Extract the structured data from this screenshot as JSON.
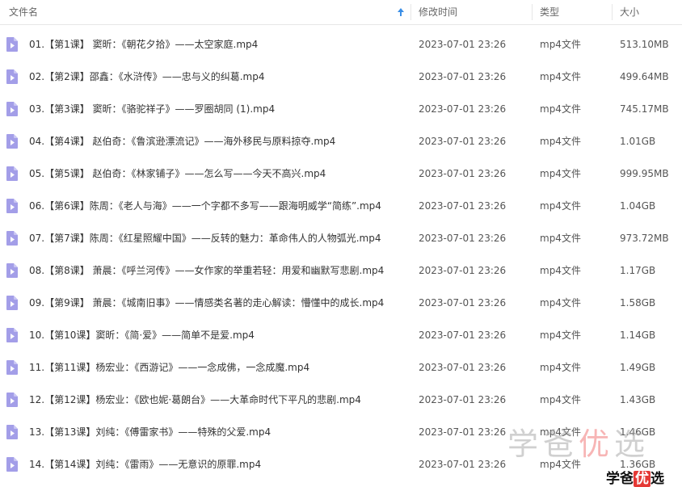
{
  "header": {
    "name": "文件名",
    "date": "修改时间",
    "type": "类型",
    "size": "大小"
  },
  "colors": {
    "file_icon": "#a39ee8",
    "sort_arrow": "#3a8ee6"
  },
  "icons": {
    "file": "video-file-icon",
    "sort": "sort-ascending-arrow-icon"
  },
  "files": [
    {
      "name": "01.【第1课】 窦昕：《朝花夕拾》——太空家庭.mp4",
      "date": "2023-07-01 23:26",
      "type": "mp4文件",
      "size": "513.10MB"
    },
    {
      "name": "02.【第2课】邵鑫：《水浒传》——忠与义的纠葛.mp4",
      "date": "2023-07-01 23:26",
      "type": "mp4文件",
      "size": "499.64MB"
    },
    {
      "name": "03.【第3课】 窦昕：《骆驼祥子》——罗圈胡同 (1).mp4",
      "date": "2023-07-01 23:26",
      "type": "mp4文件",
      "size": "745.17MB"
    },
    {
      "name": "04.【第4课】 赵伯奇：《鲁滨逊漂流记》——海外移民与原料掠夺.mp4",
      "date": "2023-07-01 23:26",
      "type": "mp4文件",
      "size": "1.01GB"
    },
    {
      "name": "05.【第5课】 赵伯奇：《林家铺子》——怎么写——今天不高兴.mp4",
      "date": "2023-07-01 23:26",
      "type": "mp4文件",
      "size": "999.95MB"
    },
    {
      "name": "06.【第6课】陈周：《老人与海》——一个字都不多写——跟海明威学“简练”.mp4",
      "date": "2023-07-01 23:26",
      "type": "mp4文件",
      "size": "1.04GB"
    },
    {
      "name": "07.【第7课】陈周：《红星照耀中国》——反转的魅力：革命伟人的人物弧光.mp4",
      "date": "2023-07-01 23:26",
      "type": "mp4文件",
      "size": "973.72MB"
    },
    {
      "name": "08.【第8课】 萧晨：《呼兰河传》——女作家的举重若轻：用爱和幽默写悲剧.mp4",
      "date": "2023-07-01 23:26",
      "type": "mp4文件",
      "size": "1.17GB"
    },
    {
      "name": "09.【第9课】 萧晨：《城南旧事》——情感类名著的走心解读：懵懂中的成长.mp4",
      "date": "2023-07-01 23:26",
      "type": "mp4文件",
      "size": "1.58GB"
    },
    {
      "name": "10.【第10课】窦昕：《简·爱》——简单不是爱.mp4",
      "date": "2023-07-01 23:26",
      "type": "mp4文件",
      "size": "1.14GB"
    },
    {
      "name": "11.【第11课】杨宏业：《西游记》——一念成佛，一念成魔.mp4",
      "date": "2023-07-01 23:26",
      "type": "mp4文件",
      "size": "1.49GB"
    },
    {
      "name": "12.【第12课】杨宏业：《欧也妮·葛朗台》——大革命时代下平凡的悲剧.mp4",
      "date": "2023-07-01 23:26",
      "type": "mp4文件",
      "size": "1.43GB"
    },
    {
      "name": "13.【第13课】刘纯：《傅雷家书》——特殊的父爱.mp4",
      "date": "2023-07-01 23:26",
      "type": "mp4文件",
      "size": "1.46GB"
    },
    {
      "name": "14.【第14课】刘纯：《雷雨》——无意识的原罪.mp4",
      "date": "2023-07-01 23:26",
      "type": "mp4文件",
      "size": "1.36GB"
    }
  ],
  "watermark": {
    "pre": "学爸",
    "hl": "优",
    "post": "选"
  },
  "logo": {
    "pre": "学爸",
    "hl": "优",
    "post": "选"
  }
}
